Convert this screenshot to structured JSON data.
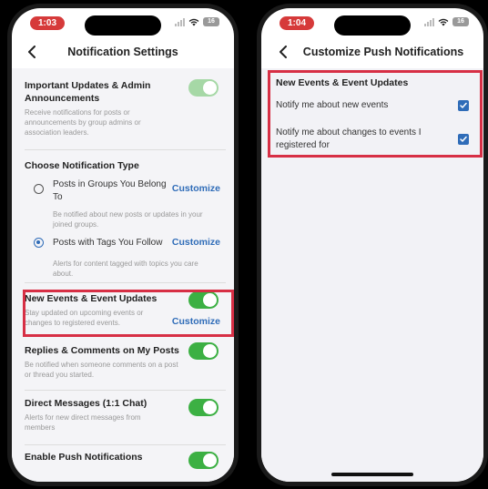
{
  "left_phone": {
    "status_time": "1:03",
    "battery": "16",
    "title": "Notification Settings",
    "important": {
      "title": "Important Updates & Admin Announcements",
      "desc": "Receive notifications for posts or announcements by group admins or association leaders."
    },
    "choose_type": {
      "title": "Choose Notification Type",
      "groups": {
        "label": "Posts in Groups You Belong To",
        "customize": "Customize",
        "desc": "Be notified about new posts or updates in your joined groups."
      },
      "tags": {
        "label": "Posts with Tags You Follow",
        "customize": "Customize",
        "desc": "Alerts for content tagged with topics you care about."
      }
    },
    "events": {
      "title": "New Events & Event Updates",
      "desc": "Stay updated on upcoming events or changes to registered events.",
      "customize": "Customize"
    },
    "replies": {
      "title": "Replies & Comments on My Posts",
      "desc": "Be notified when someone comments on a post or thread you started."
    },
    "dms": {
      "title": "Direct Messages (1:1 Chat)",
      "desc": "Alerts for new direct messages from members"
    },
    "push": {
      "title": "Enable Push Notifications"
    }
  },
  "right_phone": {
    "status_time": "1:04",
    "battery": "16",
    "title": "Customize Push Notifications",
    "section_title": "New Events & Event Updates",
    "option_new_events": "Notify me about new events",
    "option_changes": "Notify me about changes to events I registered for"
  },
  "colors": {
    "toggle_on": "#3cb043",
    "link": "#2f6cb8",
    "highlight": "#d72f45",
    "status_pill": "#d63a3a"
  }
}
